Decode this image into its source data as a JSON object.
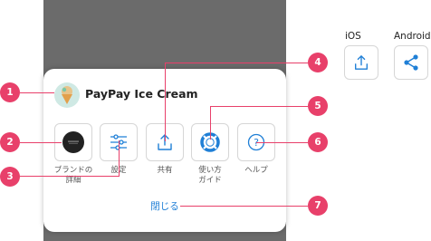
{
  "sheet": {
    "app_title": "PayPay Ice Cream",
    "actions": [
      {
        "key": "brand-details",
        "label": "ブランドの\n詳細",
        "icon": "brand-logo-icon"
      },
      {
        "key": "settings",
        "label": "設定",
        "icon": "sliders-icon"
      },
      {
        "key": "share",
        "label": "共有",
        "icon": "share-upload-icon"
      },
      {
        "key": "how-to-use",
        "label": "使い方\nガイド",
        "icon": "lifebuoy-icon"
      },
      {
        "key": "help",
        "label": "ヘルプ",
        "icon": "question-circle-icon"
      }
    ],
    "close_label": "閉じる"
  },
  "platforms": {
    "ios_label": "iOS",
    "android_label": "Android"
  },
  "callouts": [
    "1",
    "2",
    "3",
    "4",
    "5",
    "6",
    "7"
  ],
  "colors": {
    "callout": "#e8406a",
    "link": "#1f7fd6",
    "icon_blue": "#1f7fd6",
    "phone_background": "#6b6b6b"
  }
}
